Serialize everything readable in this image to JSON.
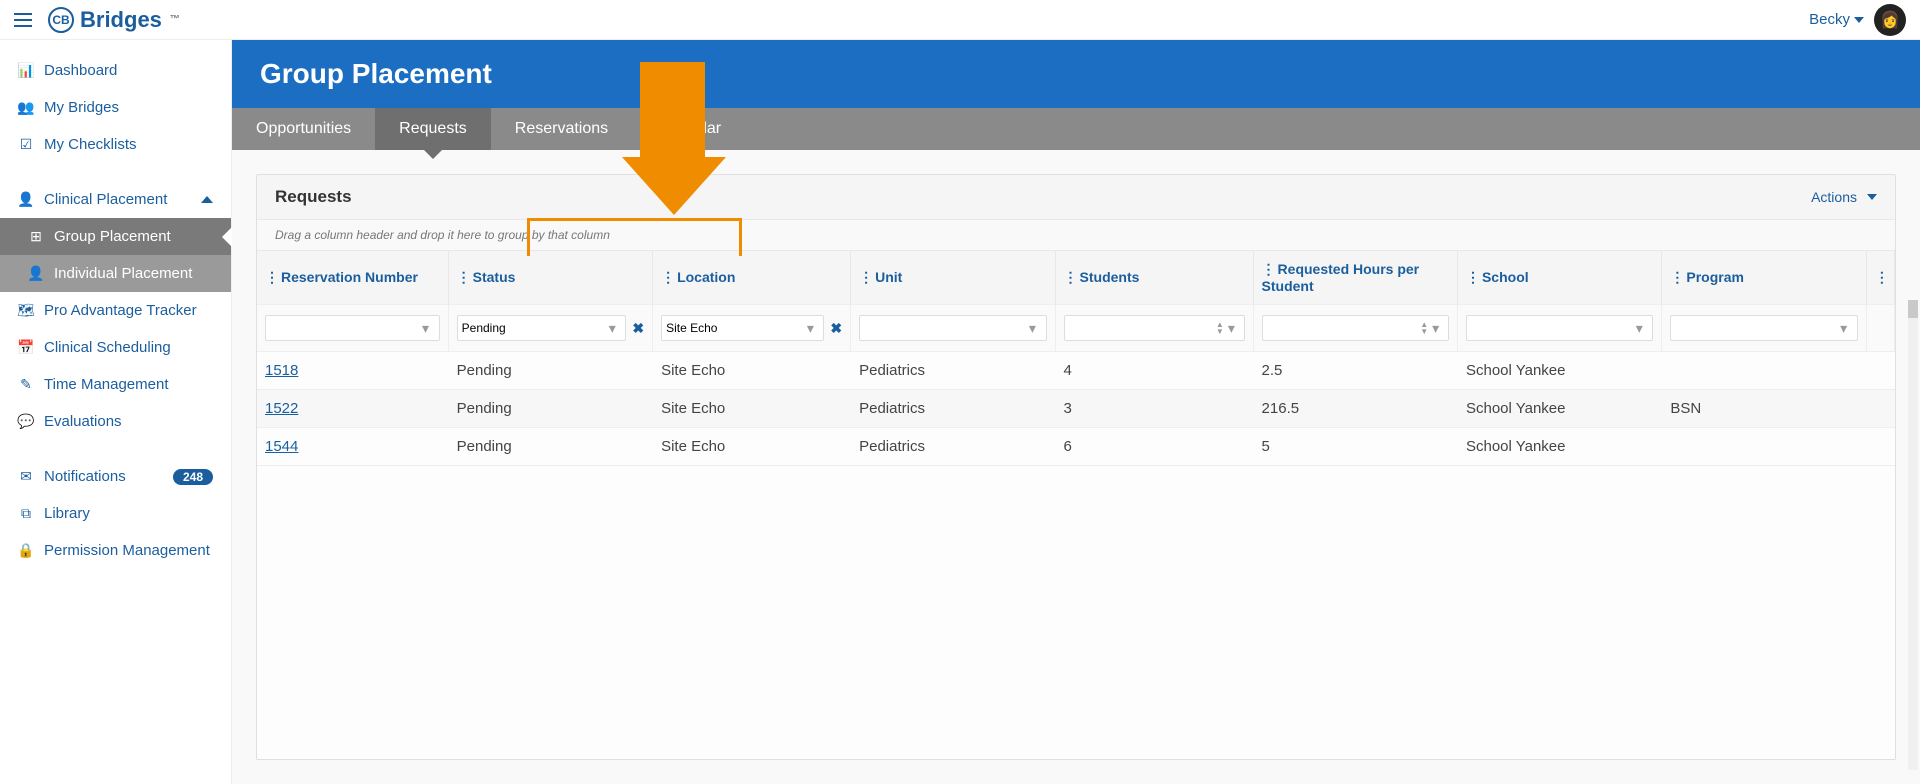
{
  "brand": {
    "name": "Bridges",
    "tm": "™",
    "badge": "CB"
  },
  "user": {
    "name": "Becky"
  },
  "sidebar": {
    "items": [
      {
        "icon": "📊",
        "label": "Dashboard"
      },
      {
        "icon": "👥",
        "label": "My Bridges"
      },
      {
        "icon": "☑",
        "label": "My Checklists"
      }
    ],
    "placement_header": {
      "icon": "👤",
      "label": "Clinical Placement"
    },
    "placement_sub": [
      {
        "icon": "⊞",
        "label": "Group Placement",
        "active": true
      },
      {
        "icon": "👤",
        "label": "Individual Placement"
      }
    ],
    "middle": [
      {
        "icon": "🗺",
        "label": "Pro Advantage Tracker"
      },
      {
        "icon": "📅",
        "label": "Clinical Scheduling"
      },
      {
        "icon": "✎",
        "label": "Time Management"
      },
      {
        "icon": "💬",
        "label": "Evaluations"
      }
    ],
    "bottom": [
      {
        "icon": "✉",
        "label": "Notifications",
        "badge": "248"
      },
      {
        "icon": "⧉",
        "label": "Library"
      },
      {
        "icon": "🔒",
        "label": "Permission Management"
      }
    ]
  },
  "page": {
    "title": "Group Placement"
  },
  "tabs": [
    {
      "label": "Opportunities"
    },
    {
      "label": "Requests",
      "active": true
    },
    {
      "label": "Reservations"
    },
    {
      "label": "Calendar"
    }
  ],
  "panel": {
    "title": "Requests",
    "actions": "Actions",
    "drag_hint": "Drag a column header and drop it here to group by that column"
  },
  "columns": [
    {
      "label": "Reservation Number"
    },
    {
      "label": "Status"
    },
    {
      "label": "Location"
    },
    {
      "label": "Unit"
    },
    {
      "label": "Students"
    },
    {
      "label": "Requested Hours per Student"
    },
    {
      "label": "School"
    },
    {
      "label": "Program"
    }
  ],
  "filters": {
    "status": "Pending",
    "location": "Site Echo"
  },
  "rows": [
    {
      "rn": "1518",
      "status": "Pending",
      "location": "Site Echo",
      "unit": "Pediatrics",
      "students": "4",
      "hours": "2.5",
      "school": "School Yankee",
      "program": ""
    },
    {
      "rn": "1522",
      "status": "Pending",
      "location": "Site Echo",
      "unit": "Pediatrics",
      "students": "3",
      "hours": "216.5",
      "school": "School Yankee",
      "program": "BSN"
    },
    {
      "rn": "1544",
      "status": "Pending",
      "location": "Site Echo",
      "unit": "Pediatrics",
      "students": "6",
      "hours": "5",
      "school": "School Yankee",
      "program": ""
    }
  ]
}
